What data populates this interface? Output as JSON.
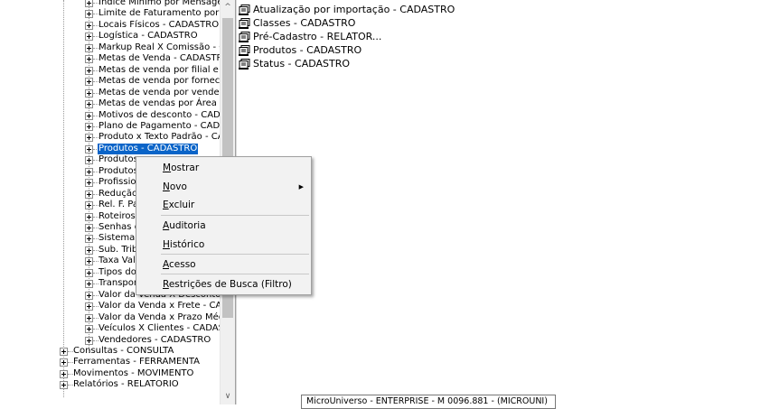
{
  "tree": {
    "items": [
      "Índice Mínimo por Mensagem Tr",
      "Limite de Faturamento por c",
      "Locais Físicos - CADASTRO",
      "Logística - CADASTRO",
      "Markup Real X Comissão - CAD",
      "Metas de Venda - CADASTRO",
      "Metas de venda por filial e mar",
      "Metas de venda por fornecedo",
      "Metas de venda por vendedor",
      "Metas de vendas por Área de V",
      "Motivos de desconto - CADAST",
      "Plano de Pagamento - CADAST",
      "Produto x Texto Padrão - CAD",
      "Produtos - CADASTRO",
      "Produtos",
      "Produtos",
      "Profissior",
      "Redução",
      "Rel. F. Pa",
      "Roteiros -",
      "Senhas d",
      "Sistema T",
      "Sub. Trib.",
      "Taxa Valo",
      "Tipos doc",
      "Transportadora - CADASTRO",
      "Valor da Venda X Desconto -",
      "Valor da Venda x Frete - CAD",
      "Valor da Venda x Prazo Médio",
      "Veículos X Clientes - CADASTR",
      "Vendedores - CADASTRO"
    ],
    "root_items": [
      "Consultas - CONSULTA",
      "Ferramentas - FERRAMENTA",
      "Movimentos - MOVIMENTO",
      "Relatórios - RELATORIO"
    ],
    "selected_index": 13
  },
  "list": {
    "items": [
      "Atualização por importação - CADASTRO",
      "Classes - CADASTRO",
      "Pré-Cadastro - RELATOR...",
      "Produtos - CADASTRO",
      "Status - CADASTRO"
    ]
  },
  "context_menu": {
    "mostrar": {
      "u": "M",
      "rest": "ostrar"
    },
    "novo": {
      "u": "N",
      "rest": "ovo"
    },
    "excluir": {
      "u": "E",
      "rest": "xcluir"
    },
    "auditoria": {
      "u": "A",
      "rest": "uditoria"
    },
    "historico": {
      "u": "H",
      "rest": "istórico"
    },
    "acesso": {
      "u": "A",
      "rest": "cesso"
    },
    "restricoes": {
      "u": "R",
      "rest": "estrições de Busca (Filtro)"
    }
  },
  "highlight_color": "#f5f500",
  "selection_color": "#0a64c8",
  "status_tip": "MicroUniverso - ENTERPRISE - M 0096.881 - (MICROUNI)",
  "icons": {
    "tree_expander": "plus-box-icon",
    "list_item": "document-stack-icon",
    "submenu": "arrow-right-icon",
    "scroll_up": "arrow-up-icon",
    "scroll_down": "arrow-down-icon"
  }
}
